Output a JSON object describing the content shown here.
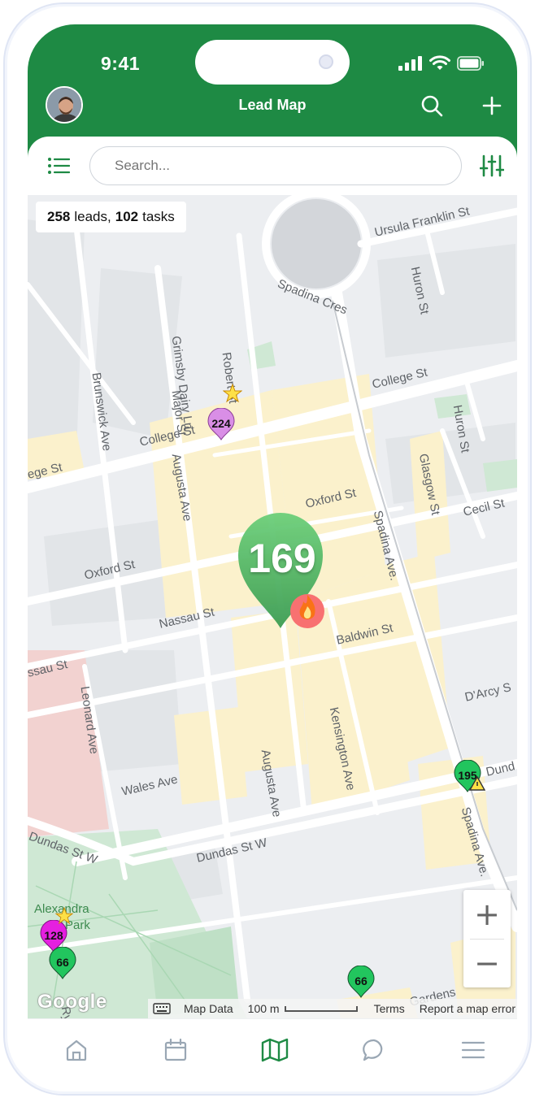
{
  "status": {
    "time": "9:41"
  },
  "header": {
    "title": "Lead Map",
    "avatar_icon": "avatar",
    "search_icon": "search-icon",
    "add_icon": "plus-icon"
  },
  "toolbar": {
    "list_icon": "list-icon",
    "search_placeholder": "Search...",
    "filter_icon": "sliders-icon"
  },
  "map": {
    "summary": {
      "leads_count": "258",
      "leads_label": "leads,",
      "tasks_count": "102",
      "tasks_label": "tasks"
    },
    "streets": {
      "ursula_franklin": "Ursula Franklin St",
      "huron_top": "Huron St",
      "spadina_cres": "Spadina Cres",
      "robert": "Robert St",
      "grimsby": "Grimsby Dairy Ln",
      "brunswick": "Brunswick Ave",
      "major": "Major St",
      "college_right": "College St",
      "huron_mid": "Huron St",
      "college_left": "College St",
      "college_far_left": "ege St",
      "augusta_top": "Augusta Ave",
      "glasgow": "Glasgow St",
      "oxford_right": "Oxford St",
      "cecil": "Cecil St",
      "spadina_ave": "Spadina Ave.",
      "oxford_left": "Oxford St",
      "nassau_mid": "Nassau St",
      "baldwin": "Baldwin St",
      "nassau_left": "ssau St",
      "leonard": "Leonard Ave",
      "darcy": "D'Arcy S",
      "kensington": "Kensington Ave",
      "augusta_bottom": "Augusta Ave",
      "wales": "Wales Ave",
      "dundas_right": "Dund",
      "spadina_ave_bottom": "Spadina Ave.",
      "dundas_w_left": "Dundas St W",
      "dundas_w_mid": "Dundas St W",
      "alexandra_park_1": "Alexandra",
      "alexandra_park_2": "Park",
      "gardens": "Gardens",
      "ryan": "Ryan"
    },
    "pins": {
      "p224": {
        "label": "224",
        "color": "#d98ee6"
      },
      "p169": {
        "label": "169",
        "color": "#4caf50",
        "badge": "flame-icon"
      },
      "p195": {
        "label": "195",
        "color": "#22c55e",
        "badge": "warning-icon"
      },
      "p128": {
        "label": "128",
        "color": "#e520e0",
        "badge": "star-icon"
      },
      "p66_left": {
        "label": "66",
        "color": "#22c55e"
      },
      "p66_bottom": {
        "label": "66",
        "color": "#22c55e"
      }
    },
    "zoom": {
      "in": "+",
      "out": "−"
    },
    "attribution": {
      "logo": "Google",
      "map_data": "Map Data",
      "scale": "100 m",
      "terms": "Terms",
      "report": "Report a map error"
    }
  },
  "tabbar": {
    "items": [
      {
        "icon": "home-icon",
        "active": false
      },
      {
        "icon": "calendar-icon",
        "active": false
      },
      {
        "icon": "map-icon",
        "active": true
      },
      {
        "icon": "chat-icon",
        "active": false
      },
      {
        "icon": "menu-icon",
        "active": false
      }
    ]
  },
  "colors": {
    "brand": "#1e8a44",
    "tab_inactive": "#9aa7b4",
    "tab_active": "#1e8a44",
    "map_block": "#fdf3d2"
  }
}
